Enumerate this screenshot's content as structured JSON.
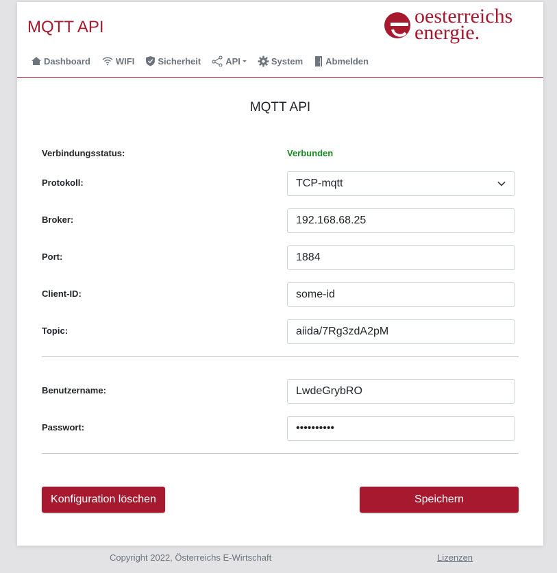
{
  "header": {
    "app_title": "MQTT API",
    "logo": {
      "line1": "oesterreichs",
      "line2": "energie."
    }
  },
  "nav": {
    "items": [
      {
        "label": "Dashboard",
        "icon": "home-icon"
      },
      {
        "label": "WIFI",
        "icon": "wifi-icon"
      },
      {
        "label": "Sicherheit",
        "icon": "shield-icon"
      },
      {
        "label": "API",
        "icon": "share-icon",
        "dropdown": true
      },
      {
        "label": "System",
        "icon": "gear-icon"
      },
      {
        "label": "Abmelden",
        "icon": "door-icon"
      }
    ]
  },
  "page": {
    "title": "MQTT API"
  },
  "form": {
    "status": {
      "label": "Verbindungsstatus:",
      "value": "Verbunden"
    },
    "protocol": {
      "label": "Protokoll:",
      "value": "TCP-mqtt"
    },
    "broker": {
      "label": "Broker:",
      "value": "192.168.68.25"
    },
    "port": {
      "label": "Port:",
      "value": "1884"
    },
    "client_id": {
      "label": "Client-ID:",
      "value": "some-id"
    },
    "topic": {
      "label": "Topic:",
      "value": "aiida/7Rg3zdA2pM"
    },
    "username": {
      "label": "Benutzername:",
      "value": "LwdeGrybRO"
    },
    "password": {
      "label": "Passwort:",
      "value": "••••••••••"
    }
  },
  "actions": {
    "delete_label": "Konfiguration löschen",
    "save_label": "Speichern"
  },
  "footer": {
    "copyright": "Copyright 2022, Österreichs E-Wirtschaft",
    "license_link": "Lizenzen"
  },
  "colors": {
    "brand": "#a6192e",
    "status_ok": "#1a8a22",
    "nav_text": "#6c757d"
  }
}
